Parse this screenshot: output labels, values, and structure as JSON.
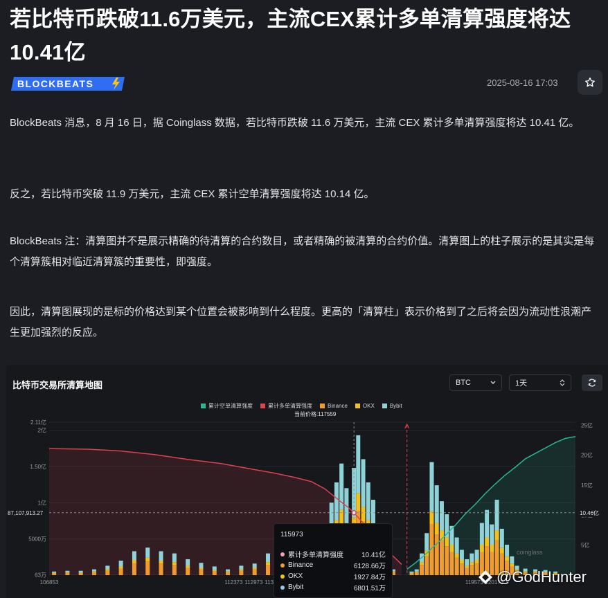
{
  "article": {
    "title": "若比特币跌破11.6万美元，主流CEX累计多单清算强度将达10.41亿",
    "source_logo": "BLOCKBEATS",
    "date": "2025-08-16 17:03",
    "paragraphs": [
      "BlockBeats 消息，8 月 16 日，据 Coinglass 数据，若比特币跌破 11.6 万美元，主流 CEX 累计多单清算强度将达 10.41 亿。",
      "反之，若比特币突破 11.9 万美元，主流 CEX 累计空单清算强度将达 10.14 亿。",
      "BlockBeats 注：清算图并不是展示精确的待清算的合约数目，或者精确的被清算的合约价值。清算图上的柱子展示的是其实是每个清算簇相对临近清算簇的重要性，即强度。",
      "因此，清算图展现的是标的价格达到某个位置会被影响到什么程度。更高的「清算柱」表示价格到了之后将会因为流动性浪潮产生更加强烈的反应。"
    ]
  },
  "chart_panel": {
    "title": "比特币交易所清算地图",
    "coin_select": "BTC",
    "range_select": "1天",
    "current_price_label": "当前价格:117559",
    "crosshair_left_label": "87,107,913.27",
    "crosshair_right_label": "10.46亿",
    "watermark": "coinglass"
  },
  "tooltip": {
    "price": "115973",
    "rows": [
      {
        "name": "累计多单清算强度",
        "value": "10.41亿",
        "color": "#f0a0a8"
      },
      {
        "name": "Binance",
        "value": "6128.66万",
        "color": "#f29a2e"
      },
      {
        "name": "OKX",
        "value": "1927.84万",
        "color": "#f2c21a"
      },
      {
        "name": "Bybit",
        "value": "6801.51万",
        "color": "#9cc8e8"
      }
    ]
  },
  "footer_watermark": "@GodHunter",
  "chart_data": {
    "type": "bar",
    "legend": [
      {
        "name": "累计空单清算强度",
        "color": "#2ab795"
      },
      {
        "name": "累计多单清算强度",
        "color": "#e0414f"
      },
      {
        "name": "Binance",
        "color": "#f29a2e"
      },
      {
        "name": "OKX",
        "color": "#f2c21a"
      },
      {
        "name": "Bybit",
        "color": "#8fd3d8"
      }
    ],
    "x_range": [
      106853,
      122600
    ],
    "current_price": 117559,
    "crosshair_price": 115973,
    "x_ticks": [
      "106853",
      "112373",
      "112973",
      "113573",
      "114173",
      "114773",
      "115373",
      "115973",
      "119573",
      "120173"
    ],
    "x_tick_values": [
      106853,
      112373,
      112973,
      113573,
      114173,
      114773,
      115373,
      115973,
      119573,
      120173
    ],
    "left_axis": {
      "ticks": [
        "2.11亿",
        "2亿",
        "1.50亿",
        "1亿",
        "5000万",
        "63万"
      ],
      "values": [
        211,
        200,
        150,
        100,
        50,
        0.63
      ],
      "max": 211
    },
    "right_axis": {
      "ticks": [
        "25亿",
        "20亿",
        "15亿",
        "10亿",
        "5亿"
      ],
      "values": [
        25,
        20,
        15,
        10,
        5
      ],
      "max": 25.5
    },
    "bars": [
      {
        "price": 107000,
        "binance": 2,
        "okx": 1,
        "bybit": 2
      },
      {
        "price": 107400,
        "binance": 3,
        "okx": 1,
        "bybit": 2
      },
      {
        "price": 107800,
        "binance": 2,
        "okx": 1,
        "bybit": 3
      },
      {
        "price": 108200,
        "binance": 4,
        "okx": 1,
        "bybit": 3
      },
      {
        "price": 108600,
        "binance": 6,
        "okx": 2,
        "bybit": 5
      },
      {
        "price": 109000,
        "binance": 9,
        "okx": 3,
        "bybit": 8
      },
      {
        "price": 109400,
        "binance": 16,
        "okx": 5,
        "bybit": 12
      },
      {
        "price": 109800,
        "binance": 19,
        "okx": 5,
        "bybit": 14
      },
      {
        "price": 110200,
        "binance": 16,
        "okx": 4,
        "bybit": 13
      },
      {
        "price": 110600,
        "binance": 14,
        "okx": 4,
        "bybit": 12
      },
      {
        "price": 111000,
        "binance": 10,
        "okx": 3,
        "bybit": 9
      },
      {
        "price": 111400,
        "binance": 8,
        "okx": 2,
        "bybit": 7
      },
      {
        "price": 111800,
        "binance": 5,
        "okx": 2,
        "bybit": 5
      },
      {
        "price": 112200,
        "binance": 4,
        "okx": 1,
        "bybit": 3
      },
      {
        "price": 112600,
        "binance": 6,
        "okx": 2,
        "bybit": 5
      },
      {
        "price": 113000,
        "binance": 8,
        "okx": 2,
        "bybit": 6
      },
      {
        "price": 113400,
        "binance": 14,
        "okx": 4,
        "bybit": 12
      },
      {
        "price": 113700,
        "binance": 18,
        "okx": 5,
        "bybit": 16
      },
      {
        "price": 114000,
        "binance": 24,
        "okx": 6,
        "bybit": 21
      },
      {
        "price": 114200,
        "binance": 22,
        "okx": 6,
        "bybit": 20
      },
      {
        "price": 114400,
        "binance": 17,
        "okx": 5,
        "bybit": 14
      },
      {
        "price": 114600,
        "binance": 19,
        "okx": 5,
        "bybit": 16
      },
      {
        "price": 114800,
        "binance": 15,
        "okx": 4,
        "bybit": 13
      },
      {
        "price": 115000,
        "binance": 24,
        "okx": 6,
        "bybit": 22
      },
      {
        "price": 115150,
        "binance": 32,
        "okx": 8,
        "bybit": 28
      },
      {
        "price": 115300,
        "binance": 48,
        "okx": 12,
        "bybit": 40
      },
      {
        "price": 115450,
        "binance": 60,
        "okx": 16,
        "bybit": 52
      },
      {
        "price": 115600,
        "binance": 71,
        "okx": 19,
        "bybit": 64
      },
      {
        "price": 115750,
        "binance": 56,
        "okx": 16,
        "bybit": 48
      },
      {
        "price": 115973,
        "binance": 61,
        "okx": 19,
        "bybit": 68
      },
      {
        "price": 116100,
        "binance": 88,
        "okx": 25,
        "bybit": 80
      },
      {
        "price": 116250,
        "binance": 74,
        "okx": 20,
        "bybit": 66
      },
      {
        "price": 116400,
        "binance": 60,
        "okx": 16,
        "bybit": 52
      },
      {
        "price": 116550,
        "binance": 48,
        "okx": 14,
        "bybit": 42
      },
      {
        "price": 116700,
        "binance": 26,
        "okx": 8,
        "bybit": 22
      },
      {
        "price": 116850,
        "binance": 10,
        "okx": 3,
        "bybit": 8
      },
      {
        "price": 117000,
        "binance": 8,
        "okx": 2,
        "bybit": 7
      },
      {
        "price": 117150,
        "binance": 4,
        "okx": 1,
        "bybit": 3
      },
      {
        "price": 117700,
        "binance": 2,
        "okx": 1,
        "bybit": 2
      },
      {
        "price": 117850,
        "binance": 4,
        "okx": 1,
        "bybit": 3
      },
      {
        "price": 118000,
        "binance": 14,
        "okx": 4,
        "bybit": 12
      },
      {
        "price": 118150,
        "binance": 26,
        "okx": 8,
        "bybit": 24
      },
      {
        "price": 118300,
        "binance": 70,
        "okx": 18,
        "bybit": 68
      },
      {
        "price": 118450,
        "binance": 56,
        "okx": 16,
        "bybit": 52
      },
      {
        "price": 118600,
        "binance": 48,
        "okx": 14,
        "bybit": 40
      },
      {
        "price": 118750,
        "binance": 40,
        "okx": 12,
        "bybit": 32
      },
      {
        "price": 118900,
        "binance": 32,
        "okx": 10,
        "bybit": 26
      },
      {
        "price": 119050,
        "binance": 24,
        "okx": 6,
        "bybit": 22
      },
      {
        "price": 119200,
        "binance": 16,
        "okx": 5,
        "bybit": 14
      },
      {
        "price": 119350,
        "binance": 10,
        "okx": 3,
        "bybit": 9
      },
      {
        "price": 119500,
        "binance": 14,
        "okx": 4,
        "bybit": 12
      },
      {
        "price": 119650,
        "binance": 16,
        "okx": 5,
        "bybit": 14
      },
      {
        "price": 119800,
        "binance": 32,
        "okx": 10,
        "bybit": 30
      },
      {
        "price": 119950,
        "binance": 40,
        "okx": 12,
        "bybit": 38
      },
      {
        "price": 120100,
        "binance": 32,
        "okx": 10,
        "bybit": 28
      },
      {
        "price": 120250,
        "binance": 48,
        "okx": 14,
        "bybit": 42
      },
      {
        "price": 120400,
        "binance": 30,
        "okx": 8,
        "bybit": 26
      },
      {
        "price": 120550,
        "binance": 20,
        "okx": 6,
        "bybit": 16
      },
      {
        "price": 120700,
        "binance": 12,
        "okx": 4,
        "bybit": 10
      },
      {
        "price": 120850,
        "binance": 6,
        "okx": 2,
        "bybit": 5
      },
      {
        "price": 121100,
        "binance": 4,
        "okx": 1,
        "bybit": 4
      },
      {
        "price": 121400,
        "binance": 4,
        "okx": 1,
        "bybit": 3
      },
      {
        "price": 121700,
        "binance": 3,
        "okx": 1,
        "bybit": 3
      },
      {
        "price": 122000,
        "binance": 2,
        "okx": 1,
        "bybit": 2
      }
    ],
    "long_cumulative": {
      "x": [
        106853,
        108000,
        109000,
        110000,
        111000,
        112000,
        113000,
        113600,
        114200,
        114700,
        115100,
        115500,
        115800,
        115973,
        116300,
        116700,
        117100,
        117400
      ],
      "y": [
        21.1,
        21.0,
        20.7,
        20.1,
        19.3,
        18.6,
        17.6,
        17.0,
        16.3,
        15.6,
        14.4,
        12.6,
        11.3,
        10.41,
        8.4,
        6.0,
        3.4,
        1.8
      ]
    },
    "short_cumulative": {
      "x": [
        117559,
        117800,
        118100,
        118400,
        118700,
        119000,
        119300,
        119600,
        119900,
        120200,
        120500,
        120800,
        121100,
        121400,
        121700,
        122000,
        122300,
        122600
      ],
      "y": [
        1.0,
        2.0,
        3.4,
        5.0,
        6.6,
        8.3,
        10.2,
        11.8,
        13.6,
        15.2,
        16.7,
        18.0,
        19.4,
        20.3,
        21.2,
        22.1,
        22.8,
        23.1
      ]
    }
  }
}
